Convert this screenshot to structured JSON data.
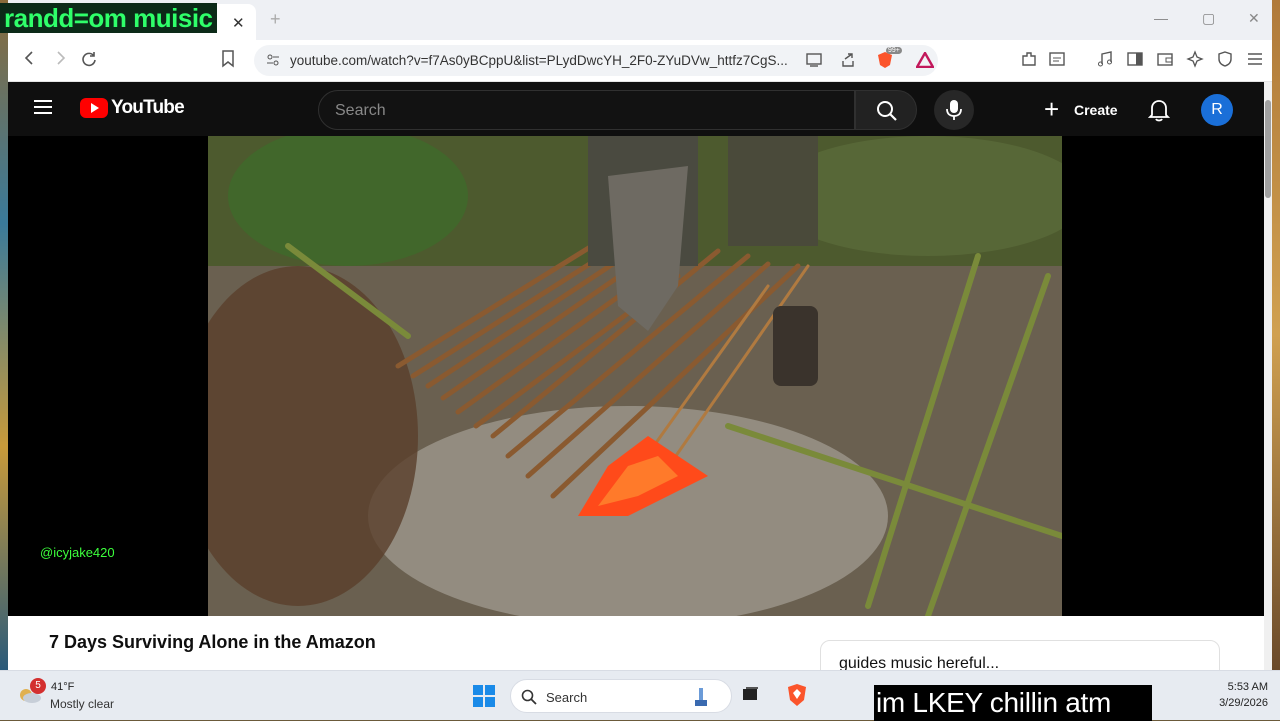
{
  "overlay": {
    "banner": "randd=om muisic",
    "watermark": "@icyjake420",
    "chat": "im LKEY chillin atm"
  },
  "browser": {
    "tab_close": "✕",
    "new_tab": "+",
    "window_controls": {
      "minimize": "—",
      "maximize": "▢",
      "close": "✕"
    },
    "address": "youtube.com/watch?v=f7As0yBCppU&list=PLydDwcYH_2F0-ZYuDVw_httfz7CgS...",
    "shield_badge": "99+"
  },
  "youtube": {
    "logo_text": "YouTube",
    "search_placeholder": "Search",
    "create_label": "Create",
    "create_plus": "+",
    "avatar_letter": "R",
    "video_title": "7 Days Surviving Alone in the Amazon",
    "side_card_text": "guides music hereful...",
    "colors": {
      "brand_red": "#ff0000",
      "avatar_blue": "#1a6fd8"
    }
  },
  "taskbar": {
    "weather_badge": "5",
    "weather_temp": "41°F",
    "weather_desc": "Mostly clear",
    "search_label": "Search",
    "time": "5:53 AM",
    "date": "3/29/2026"
  }
}
